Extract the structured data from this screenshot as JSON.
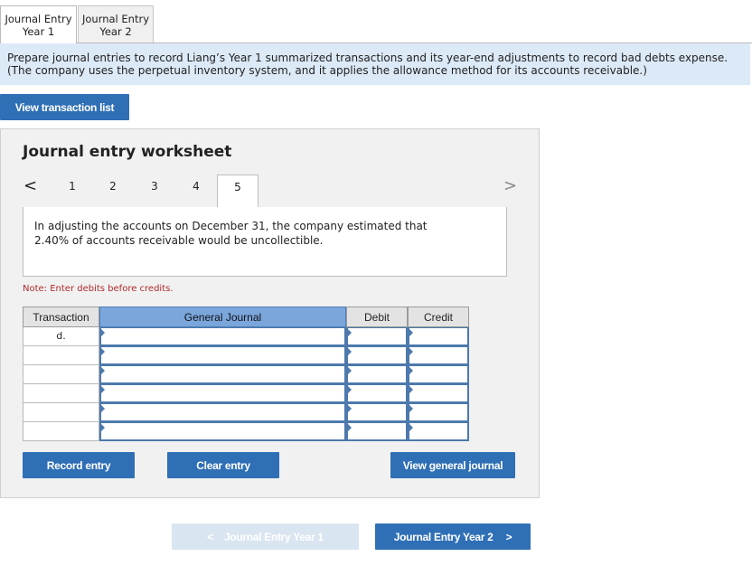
{
  "tabs": [
    {
      "line1": "Journal Entry",
      "line2": "Year 1"
    },
    {
      "line1": "Journal Entry",
      "line2": "Year 2"
    }
  ],
  "instructions": {
    "line1": "Prepare journal entries to record Liang’s Year 1 summarized transactions and its year-end adjustments to record bad debts expense.",
    "line2": "(The company uses the perpetual inventory system, and it applies the allowance method for its accounts receivable.)"
  },
  "view_transaction_list_label": "View transaction list",
  "worksheet": {
    "title": "Journal entry worksheet",
    "prev_glyph": "<",
    "next_glyph": ">",
    "steps": [
      "1",
      "2",
      "3",
      "4",
      "5"
    ],
    "description": {
      "line1": "In adjusting the accounts on December 31, the company estimated that",
      "line2": "2.40% of accounts receivable would be uncollectible."
    },
    "note": "Note: Enter debits before credits.",
    "table": {
      "headers": {
        "transaction": "Transaction",
        "general_journal": "General Journal",
        "debit": "Debit",
        "credit": "Credit"
      },
      "rows": [
        {
          "transaction": "d."
        },
        {
          "transaction": ""
        },
        {
          "transaction": ""
        },
        {
          "transaction": ""
        },
        {
          "transaction": ""
        },
        {
          "transaction": ""
        }
      ]
    },
    "buttons": {
      "record": "Record entry",
      "clear": "Clear entry",
      "view_general_journal": "View general journal"
    }
  },
  "nav": {
    "prev_label": "Journal Entry Year 1",
    "prev_glyph": "<",
    "next_label": "Journal Entry Year 2",
    "next_glyph": ">"
  },
  "colors": {
    "primary_button": "#2f6fb6",
    "banner_bg": "#dce9f7",
    "header_blue": "#7aa6dc",
    "note_red": "#b02a2a",
    "disabled_button": "#d9e5f1"
  }
}
